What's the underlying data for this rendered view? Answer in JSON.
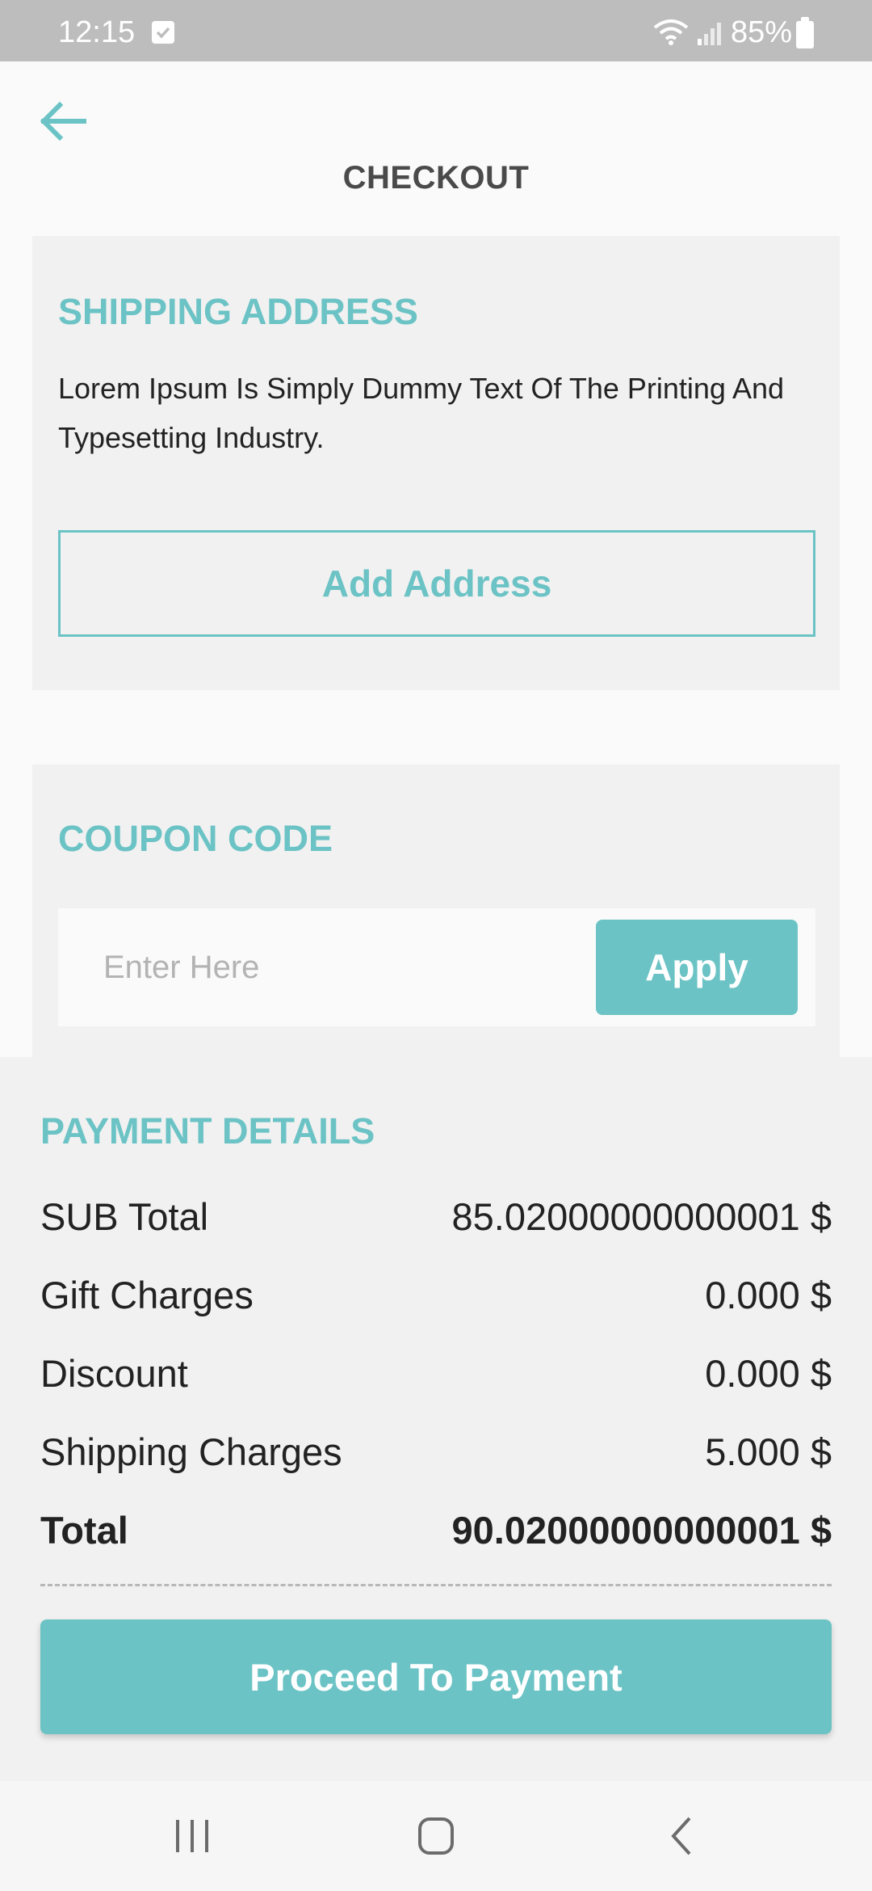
{
  "status_bar": {
    "time": "12:15",
    "battery": "85%",
    "icons": [
      "check-notification-icon",
      "wifi-icon",
      "signal-icon",
      "battery-icon"
    ]
  },
  "header": {
    "title": "CHECKOUT",
    "back_icon": "arrow-left-icon"
  },
  "shipping": {
    "title": "SHIPPING ADDRESS",
    "address": "Lorem Ipsum Is Simply Dummy Text Of The Printing And Typesetting Industry.",
    "add_button": "Add Address"
  },
  "coupon": {
    "title": "COUPON CODE",
    "placeholder": "Enter Here",
    "value": "",
    "apply_button": "Apply"
  },
  "payment": {
    "title": "PAYMENT DETAILS",
    "rows": [
      {
        "label": "SUB Total",
        "value": "85.02000000000001 $"
      },
      {
        "label": "Gift Charges",
        "value": "0.000 $"
      },
      {
        "label": "Discount",
        "value": "0.000 $"
      },
      {
        "label": "Shipping Charges",
        "value": "5.000 $"
      }
    ],
    "total": {
      "label": "Total",
      "value": "90.02000000000001 $"
    },
    "proceed_button": "Proceed To Payment"
  },
  "nav_bar": {
    "icons": [
      "recent-apps-icon",
      "home-icon",
      "back-icon"
    ]
  },
  "colors": {
    "accent": "#6cc3c5",
    "card_bg": "#f1f1f1",
    "page_bg": "#fafafa",
    "status_bar": "#bdbdbd",
    "text": "#222222"
  }
}
